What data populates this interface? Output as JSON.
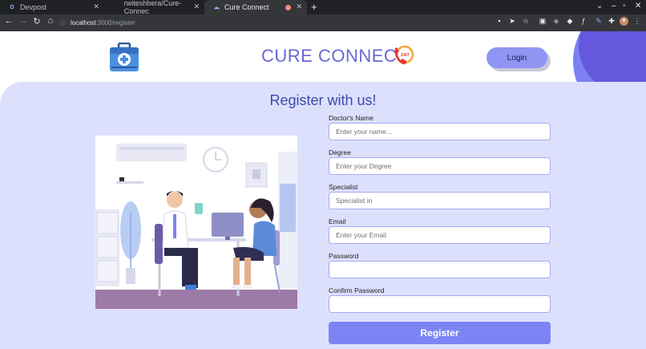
{
  "browser": {
    "tabs": [
      {
        "title": "Devpost",
        "favicon": "D"
      },
      {
        "title": "rwiteshbera/Cure-Connec",
        "favicon": "github-icon"
      },
      {
        "title": "Cure Connect",
        "favicon": "globe-icon",
        "active": true
      }
    ],
    "url_host": "localhost",
    "url_path": ":3000/register"
  },
  "header": {
    "brand": "CURE CONNECT",
    "badge_text": "24/7",
    "login_label": "Login"
  },
  "main": {
    "title": "Register with us!",
    "fields": [
      {
        "label": "Doctor's Name",
        "placeholder": "Enter your name...",
        "value": ""
      },
      {
        "label": "Degree",
        "placeholder": "Enter your Degree",
        "value": ""
      },
      {
        "label": "Specialist",
        "placeholder": "Specialist in",
        "value": ""
      },
      {
        "label": "Email",
        "placeholder": "Enter your Email",
        "value": ""
      },
      {
        "label": "Password",
        "placeholder": "",
        "value": ""
      },
      {
        "label": "Confirm Password",
        "placeholder": "",
        "value": ""
      }
    ],
    "register_label": "Register"
  },
  "colors": {
    "accent": "#7c84f5",
    "brand": "#6a67d6",
    "panel": "#dde0fd"
  }
}
